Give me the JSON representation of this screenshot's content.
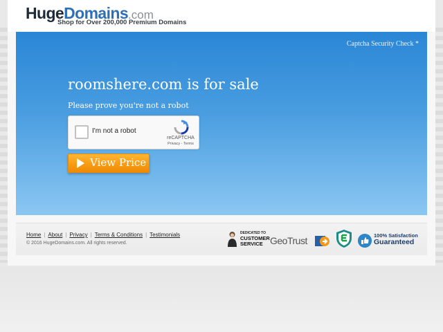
{
  "brand": {
    "logo_huge": "Huge",
    "logo_domains": "Domains",
    "logo_com": ".com",
    "tagline": "Shop for Over 200,000 Premium Domains"
  },
  "hero": {
    "captcha_check": "Captcha Security Check *",
    "title": "roomshere.com is for sale",
    "subtitle": "Please prove you're not a robot",
    "recaptcha": {
      "label": "I'm not a robot",
      "brand": "reCAPTCHA",
      "terms": "Privacy - Terms",
      "checked": false
    },
    "view_price_label": "View Price"
  },
  "footer": {
    "links": [
      {
        "label": "Home"
      },
      {
        "label": "About"
      },
      {
        "label": "Privacy"
      },
      {
        "label": "Terms & Conditions"
      },
      {
        "label": "Testimonials"
      }
    ],
    "copyright": "© 2016 HugeDomains.com. All rights reserved.",
    "badges": {
      "customer_service_small": "DEDICATED TO",
      "customer_service_big_1": "CUSTOMER",
      "customer_service_big_2": "SERVICE",
      "geotrust": "GeoTrust",
      "satisfaction_small": "100% Satisfaction",
      "satisfaction_big": "Guaranteed"
    }
  },
  "colors": {
    "hero_top": "#2a86d6",
    "hero_bottom": "#8bc7f2",
    "button_orange": "#f79a12",
    "logo_blue": "#2f6fb5"
  }
}
